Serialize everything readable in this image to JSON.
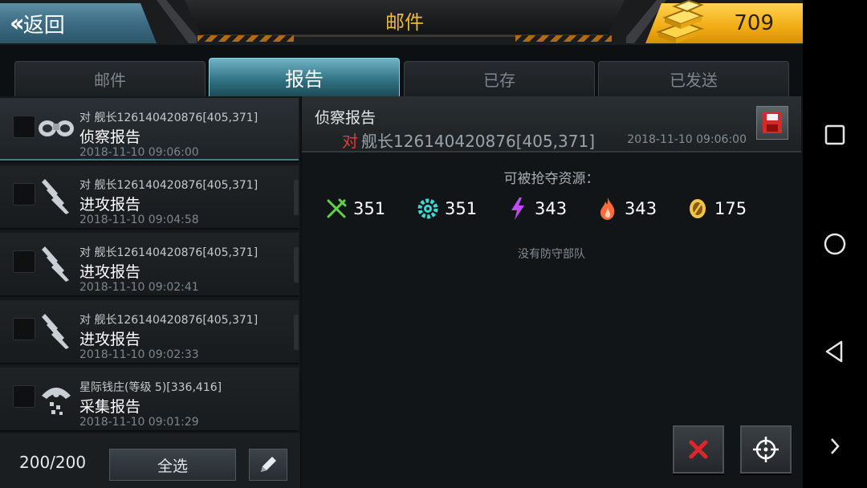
{
  "header": {
    "back_label": "返回",
    "title": "邮件",
    "gold": "709"
  },
  "tabs": [
    {
      "label": "邮件",
      "active": false
    },
    {
      "label": "报告",
      "active": true
    },
    {
      "label": "已存",
      "active": false
    },
    {
      "label": "已发送",
      "active": false
    }
  ],
  "mail_list": [
    {
      "subtitle": "对 舰长126140420876[405,371]",
      "title": "侦察报告",
      "time": "2018-11-10 09:06:00",
      "icon": "binoculars-icon",
      "selected": true
    },
    {
      "subtitle": "对 舰长126140420876[405,371]",
      "title": "进攻报告",
      "time": "2018-11-10 09:04:58",
      "icon": "missiles-icon",
      "selected": false
    },
    {
      "subtitle": "对 舰长126140420876[405,371]",
      "title": "进攻报告",
      "time": "2018-11-10 09:02:41",
      "icon": "missiles-icon",
      "selected": false
    },
    {
      "subtitle": "对 舰长126140420876[405,371]",
      "title": "进攻报告",
      "time": "2018-11-10 09:02:33",
      "icon": "missiles-icon",
      "selected": false
    },
    {
      "subtitle": "星际钱庄(等级 5)[336,416]",
      "title": "采集报告",
      "time": "2018-11-10 09:01:29",
      "icon": "harvester-icon",
      "selected": false
    }
  ],
  "footer": {
    "count": "200/200",
    "select_all_label": "全选"
  },
  "detail": {
    "title": "侦察报告",
    "target_prefix": "对",
    "target": "舰长126140420876[405,371]",
    "time": "2018-11-10 09:06:00",
    "resources_label": "可被抢夺资源：",
    "resources": [
      {
        "icon": "food-icon",
        "value": "351",
        "color": "#5fd24a"
      },
      {
        "icon": "gear-icon",
        "value": "351",
        "color": "#3fd7d0"
      },
      {
        "icon": "lightning-icon",
        "value": "343",
        "color": "#c04bff"
      },
      {
        "icon": "fire-icon",
        "value": "343",
        "color": "#ff6a3d"
      },
      {
        "icon": "coin-icon",
        "value": "175",
        "color": "#f2c44a"
      }
    ],
    "no_defense": "没有防守部队"
  },
  "colors": {
    "accent_teal": "#3f7f8f",
    "gold": "#f1ac15",
    "title_text": "#f3b736",
    "delete_red": "#e0242b"
  }
}
